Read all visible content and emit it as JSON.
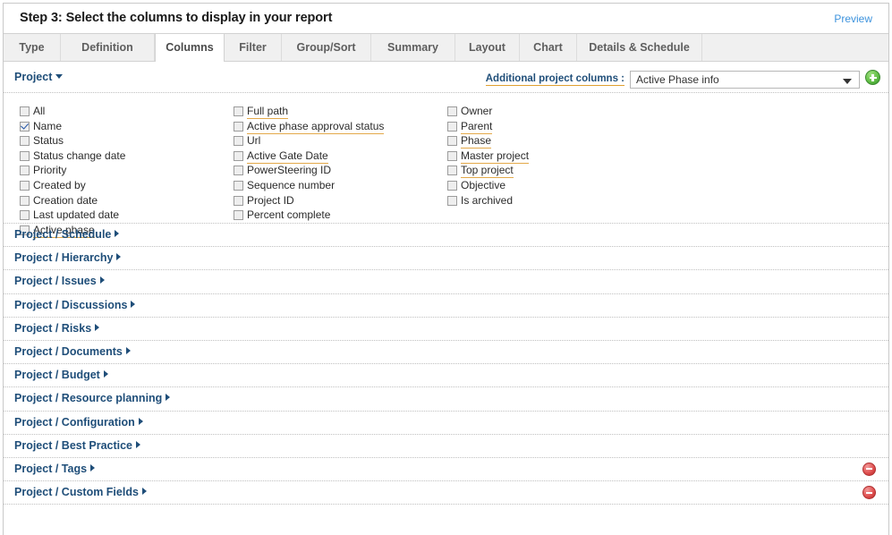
{
  "header": {
    "title": "Step 3: Select the columns to display in your report",
    "preview_label": "Preview"
  },
  "tabs": [
    {
      "label": "Type",
      "active": false
    },
    {
      "label": "Definition",
      "active": false
    },
    {
      "label": "Columns",
      "active": true
    },
    {
      "label": "Filter",
      "active": false
    },
    {
      "label": "Group/Sort",
      "active": false
    },
    {
      "label": "Summary",
      "active": false
    },
    {
      "label": "Layout",
      "active": false
    },
    {
      "label": "Chart",
      "active": false
    },
    {
      "label": "Details & Schedule",
      "active": false
    }
  ],
  "project_section": {
    "label": "Project",
    "caret_icon": "caret-down-icon",
    "additional_columns_label": "Additional project columns :",
    "additional_columns_value": "Active Phase info",
    "add_icon": "add-circle-icon"
  },
  "columns": [
    [
      {
        "label": "All",
        "checked": false,
        "underlined": false
      },
      {
        "label": "Name",
        "checked": true,
        "underlined": false
      },
      {
        "label": "Status",
        "checked": false,
        "underlined": false
      },
      {
        "label": "Status change date",
        "checked": false,
        "underlined": false
      },
      {
        "label": "Priority",
        "checked": false,
        "underlined": false
      },
      {
        "label": "Created by",
        "checked": false,
        "underlined": false
      },
      {
        "label": "Creation date",
        "checked": false,
        "underlined": false
      },
      {
        "label": "Last updated date",
        "checked": false,
        "underlined": false
      },
      {
        "label": "Active phase",
        "checked": false,
        "underlined": true
      }
    ],
    [
      {
        "label": "Full path",
        "checked": false,
        "underlined": true
      },
      {
        "label": "Active phase approval status",
        "checked": false,
        "underlined": true
      },
      {
        "label": "Url",
        "checked": false,
        "underlined": false
      },
      {
        "label": "Active Gate Date",
        "checked": false,
        "underlined": true
      },
      {
        "label": "PowerSteering ID",
        "checked": false,
        "underlined": false
      },
      {
        "label": "Sequence number",
        "checked": false,
        "underlined": false
      },
      {
        "label": "Project ID",
        "checked": false,
        "underlined": false
      },
      {
        "label": "Percent complete",
        "checked": false,
        "underlined": false
      }
    ],
    [
      {
        "label": "Owner",
        "checked": false,
        "underlined": false
      },
      {
        "label": "Parent",
        "checked": false,
        "underlined": true
      },
      {
        "label": "Phase",
        "checked": false,
        "underlined": true
      },
      {
        "label": "Master project",
        "checked": false,
        "underlined": true
      },
      {
        "label": "Top project",
        "checked": false,
        "underlined": true
      },
      {
        "label": "Objective",
        "checked": false,
        "underlined": false
      },
      {
        "label": "Is archived",
        "checked": false,
        "underlined": false
      }
    ]
  ],
  "groups": [
    {
      "label": "Project / Schedule",
      "removable": false
    },
    {
      "label": "Project / Hierarchy",
      "removable": false
    },
    {
      "label": "Project / Issues",
      "removable": false
    },
    {
      "label": "Project / Discussions",
      "removable": false
    },
    {
      "label": "Project / Risks",
      "removable": false
    },
    {
      "label": "Project / Documents",
      "removable": false
    },
    {
      "label": "Project / Budget",
      "removable": false
    },
    {
      "label": "Project / Resource planning",
      "removable": false
    },
    {
      "label": "Project / Configuration",
      "removable": false
    },
    {
      "label": "Project / Best Practice",
      "removable": false
    },
    {
      "label": "Project / Tags",
      "removable": true
    },
    {
      "label": "Project / Custom Fields",
      "removable": true
    }
  ],
  "colors": {
    "link": "#3d93dd",
    "group_label": "#1f4e79",
    "underline_accent": "#e3a94a",
    "add_green": "#62bf46",
    "remove_red": "#e05252"
  }
}
